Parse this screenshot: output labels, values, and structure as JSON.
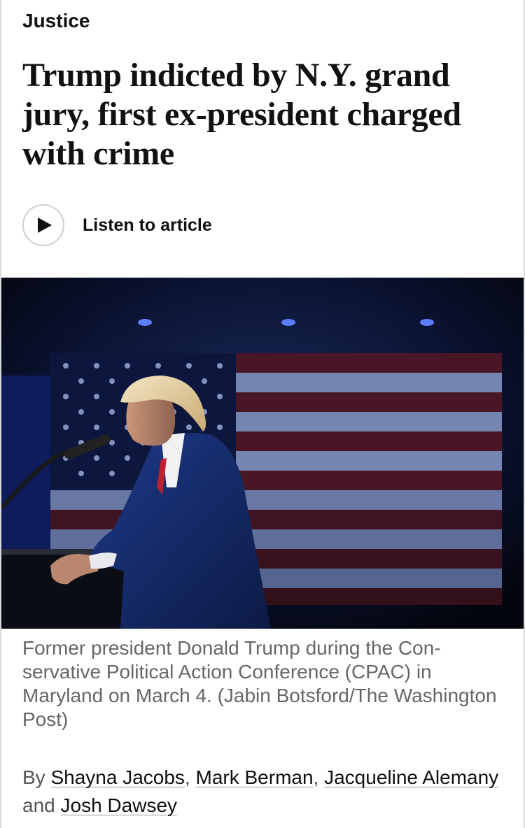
{
  "article": {
    "section": "Justice",
    "headline": "Trump indicted by N.Y. grand jury, first ex-president charged with crime",
    "listen_label": "Listen to article",
    "photo": {
      "caption": "Former president Donald Trump during the Con-servative Political Action Conference (CPAC) in Maryland on March 4. (Jabin Botsford/The Washington Post)"
    },
    "byline": {
      "prefix": "By",
      "authors": [
        "Shayna Jacobs",
        "Mark Berman",
        "Jacqueline Alemany",
        "Josh Dawsey"
      ],
      "separator": ",",
      "conjunction": "and"
    }
  },
  "icons": {
    "play": "play-icon"
  },
  "colors": {
    "text": "#111111",
    "caption": "#666666",
    "border": "#cfcfcf",
    "photo_background": "#05070f"
  }
}
